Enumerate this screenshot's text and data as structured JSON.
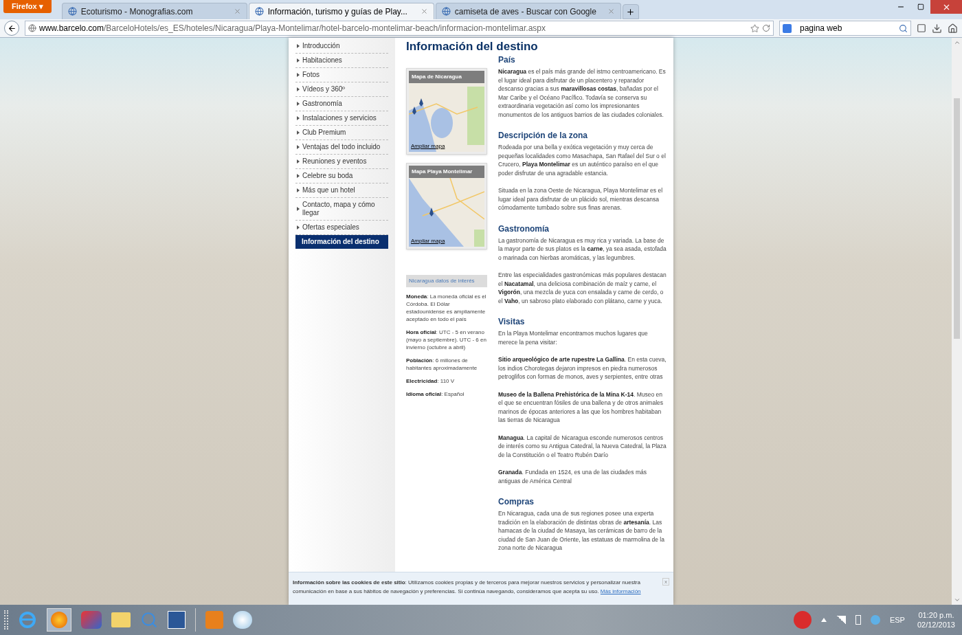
{
  "browser": {
    "menu_button": "Firefox ▾",
    "tabs": [
      {
        "title": "Ecoturismo - Monografias.com",
        "selected": false
      },
      {
        "title": "Información, turismo y guías de Play...",
        "selected": true
      },
      {
        "title": "camiseta de aves - Buscar con Google",
        "selected": false
      }
    ],
    "url_host": "www.barcelo.com",
    "url_path": "/BarceloHotels/es_ES/hoteles/Nicaragua/Playa-Montelimar/hotel-barcelo-montelimar-beach/informacion-montelimar.aspx",
    "search_value": "pagina web"
  },
  "sidebar": {
    "items": [
      {
        "label": "Introducción",
        "selected": false
      },
      {
        "label": "Habitaciones",
        "selected": false
      },
      {
        "label": "Fotos",
        "selected": false
      },
      {
        "label": "Vídeos y 360º",
        "selected": false
      },
      {
        "label": "Gastronomía",
        "selected": false
      },
      {
        "label": "Instalaciones y servicios",
        "selected": false
      },
      {
        "label": "Club Premium",
        "selected": false
      },
      {
        "label": "Ventajas del todo incluido",
        "selected": false
      },
      {
        "label": "Reuniones y eventos",
        "selected": false
      },
      {
        "label": "Celebre su boda",
        "selected": false
      },
      {
        "label": "Más que un hotel",
        "selected": false
      },
      {
        "label": "Contacto, mapa y cómo llegar",
        "selected": false
      },
      {
        "label": "Ofertas especiales",
        "selected": false
      },
      {
        "label": "Información del destino",
        "selected": true
      }
    ]
  },
  "page_title": "Información del destino",
  "maps": [
    {
      "title": "Mapa de Nicaragua",
      "link": "Ampliar mapa"
    },
    {
      "title": "Mapa Playa Montelimar",
      "link": "Ampliar mapa"
    }
  ],
  "facts": {
    "title": "Nicaragua datos de interés",
    "items": [
      "**Moneda**: La moneda oficial es el Córdoba. El Dólar estadounidense es ampliamente aceptado en todo el país",
      "**Hora oficial**: UTC - 5 en verano (mayo a septiembre). UTC - 6 en invierno (octubre a abril)",
      "**Población**: 6 millones de habitantes aproximadamente",
      "**Electricidad**: 110 V",
      "**Idioma oficial**: Español"
    ]
  },
  "sections": [
    {
      "heading": "País",
      "paragraphs": [
        "**Nicaragua** es el país más grande del istmo centroamericano. Es el lugar ideal para disfrutar de un placentero y reparador descanso gracias a sus **maravillosas costas**, bañadas por el Mar Caribe y el Océano Pacífico. Todavía se conserva su extraordinaria vegetación así como los impresionantes monumentos de los antiguos barrios de las ciudades coloniales."
      ]
    },
    {
      "heading": "Descripción de la zona",
      "paragraphs": [
        "Rodeada por una bella y exótica vegetación y muy cerca de pequeñas localidades como Masachapa, San Rafael del Sur o el Crucero, **Playa Montelimar** es un auténtico paraíso en el que poder disfrutar de una agradable estancia.",
        "Situada en la zona Oeste de Nicaragua, Playa Montelimar es el lugar ideal para disfrutar de un plácido sol, mientras descansa cómodamente tumbado sobre sus finas arenas."
      ]
    },
    {
      "heading": "Gastronomía",
      "paragraphs": [
        "La gastronomía de Nicaragua es muy rica y variada. La base de la mayor parte de sus platos es la **carne**, ya sea asada, estofada o marinada con hierbas aromáticas, y las legumbres.",
        "Entre las especialidades gastronómicas más populares destacan el **Nacatamal**, una deliciosa combinación de maíz y carne, el **Vigorón**, una mezcla de yuca con ensalada y carne de cerdo, o el **Vaho**, un sabroso plato elaborado con plátano, carne y yuca."
      ]
    },
    {
      "heading": "Visitas",
      "paragraphs": [
        "En la Playa Montelimar encontramos muchos lugares que merece la pena visitar:",
        "**Sitio arqueológico de arte rupestre La Gallina**. En esta cueva, los indios Chorotegas dejaron impresos en piedra numerosos petroglifos con formas de monos, aves y serpientes, entre otras",
        "**Museo de la Ballena Prehistórica de la Mina K-14**. Museo en el que se encuentran fósiles de una ballena y de otros animales marinos de épocas anteriores a las que los hombres habitaban las tierras de Nicaragua",
        "**Managua**. La capital de Nicaragua esconde numerosos centros de interés como su Antigua Catedral, la Nueva Catedral, la Plaza de la Constitución o el Teatro Rubén Darío",
        "**Granada**. Fundada en 1524, es una de las ciudades más antiguas de América Central"
      ]
    },
    {
      "heading": "Compras",
      "paragraphs": [
        "En Nicaragua, cada una de sus regiones posee una experta tradición en la elaboración de distintas obras de **artesanía**. Las hamacas de la ciudad de Masaya, las cerámicas de barro de la ciudad de San Juan de Oriente, las estatuas de marmolina de la zona norte de Nicaragua"
      ]
    }
  ],
  "cookie_bar": {
    "text": "**Información sobre las cookies de este sitio**: Utilizamos cookies propias y de terceros para mejorar nuestros servicios y personalizar nuestra comunicación en base a sus hábitos de navegación y preferencias. Si continúa navegando, consideramos que acepta su uso.",
    "link": "Más información",
    "close": "x"
  },
  "taskbar": {
    "language": "ESP",
    "time": "01:20 p.m.",
    "date": "02/12/2013"
  }
}
